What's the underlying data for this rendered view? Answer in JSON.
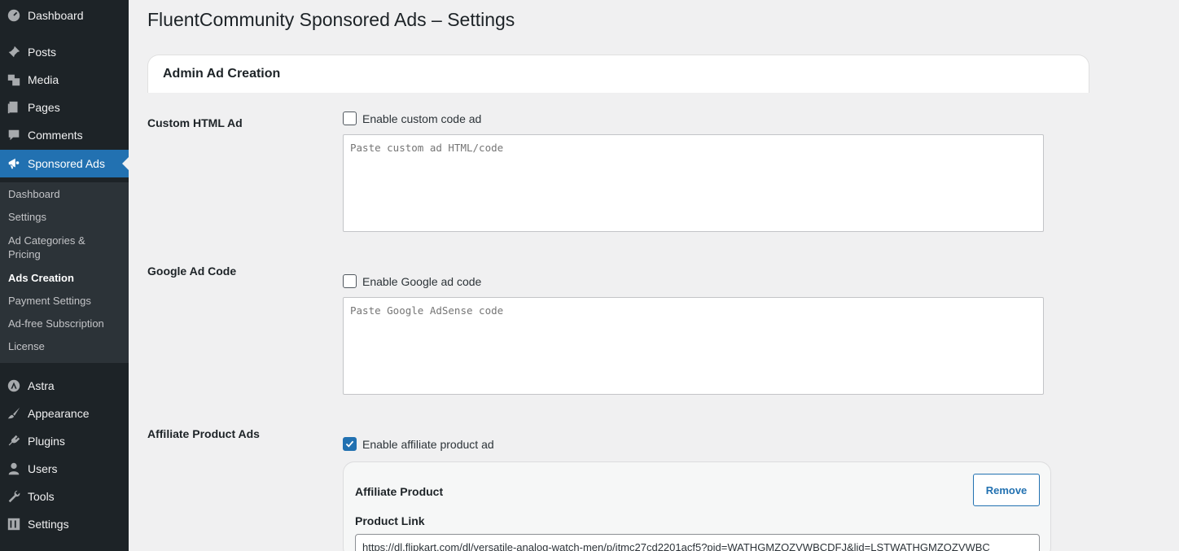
{
  "sidebar": {
    "items": [
      {
        "label": "Dashboard",
        "icon": "dashboard-icon"
      },
      {
        "label": "Posts",
        "icon": "pin-icon"
      },
      {
        "label": "Media",
        "icon": "media-icon"
      },
      {
        "label": "Pages",
        "icon": "pages-icon"
      },
      {
        "label": "Comments",
        "icon": "comments-icon"
      },
      {
        "label": "Sponsored Ads",
        "icon": "megaphone-icon"
      },
      {
        "label": "Astra",
        "icon": "astra-icon"
      },
      {
        "label": "Appearance",
        "icon": "brush-icon"
      },
      {
        "label": "Plugins",
        "icon": "plug-icon"
      },
      {
        "label": "Users",
        "icon": "user-icon"
      },
      {
        "label": "Tools",
        "icon": "wrench-icon"
      },
      {
        "label": "Settings",
        "icon": "settings-icon"
      }
    ],
    "submenu": [
      {
        "label": "Dashboard"
      },
      {
        "label": "Settings"
      },
      {
        "label": "Ad Categories & Pricing"
      },
      {
        "label": "Ads Creation"
      },
      {
        "label": "Payment Settings"
      },
      {
        "label": "Ad-free Subscription"
      },
      {
        "label": "License"
      }
    ]
  },
  "page": {
    "title": "FluentCommunity Sponsored Ads – Settings",
    "card_title": "Admin Ad Creation"
  },
  "custom_html": {
    "label": "Custom HTML Ad",
    "checkbox_label": "Enable custom code ad",
    "checked": false,
    "placeholder": "Paste custom ad HTML/code"
  },
  "google": {
    "label": "Google Ad Code",
    "checkbox_label": "Enable Google ad code",
    "checked": false,
    "placeholder": "Paste Google AdSense code"
  },
  "affiliate": {
    "label": "Affiliate Product Ads",
    "checkbox_label": "Enable affiliate product ad",
    "checked": true,
    "box_title": "Affiliate Product",
    "remove_label": "Remove",
    "link_label": "Product Link",
    "link_value": "https://dl.flipkart.com/dl/versatile-analog-watch-men/p/itmc27cd2201acf5?pid=WATHGMZQZVWBCDFJ&lid=LSTWATHGMZQZVWBC"
  },
  "colors": {
    "sidebar_bg": "#1d2327",
    "submenu_bg": "#2c3338",
    "accent": "#2271b1",
    "page_bg": "#f0f0f1"
  }
}
